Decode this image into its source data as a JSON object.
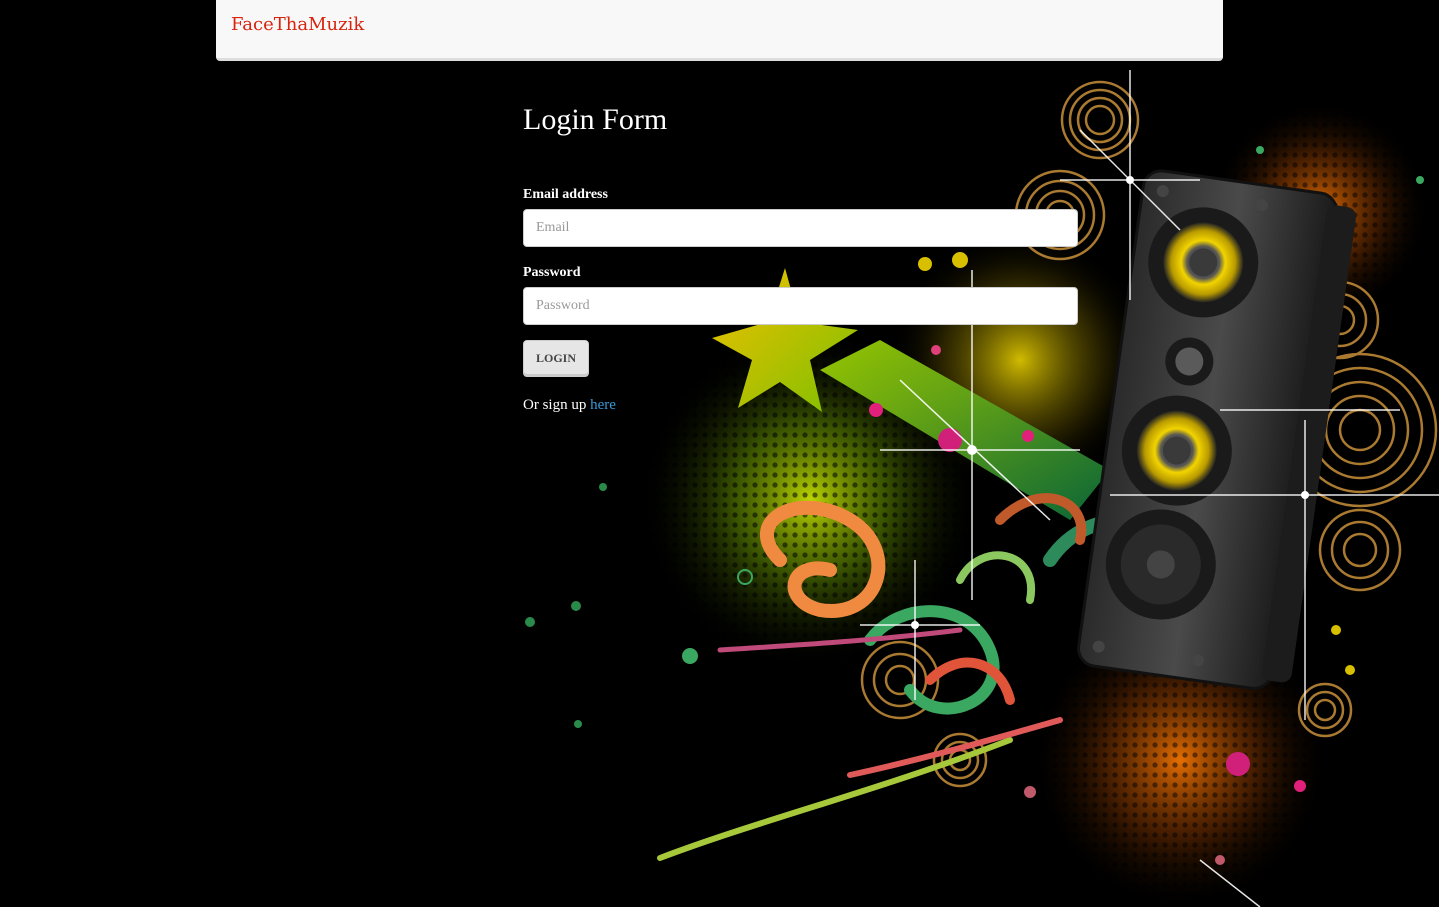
{
  "navbar": {
    "brand": "FaceThaMuzik"
  },
  "login_form": {
    "title": "Login Form",
    "email_label": "Email address",
    "email_placeholder": "Email",
    "email_value": "",
    "password_label": "Password",
    "password_placeholder": "Password",
    "password_value": "",
    "login_button": "LOGIN",
    "signup_prefix": "Or sign up",
    "signup_link": "here"
  },
  "colors": {
    "page_background": "#000000",
    "navbar_background": "#f8f8f8",
    "brand": "#d9230f",
    "link": "#3a9ad9"
  },
  "background_image": {
    "subject": "speaker with colorful music swirls"
  }
}
